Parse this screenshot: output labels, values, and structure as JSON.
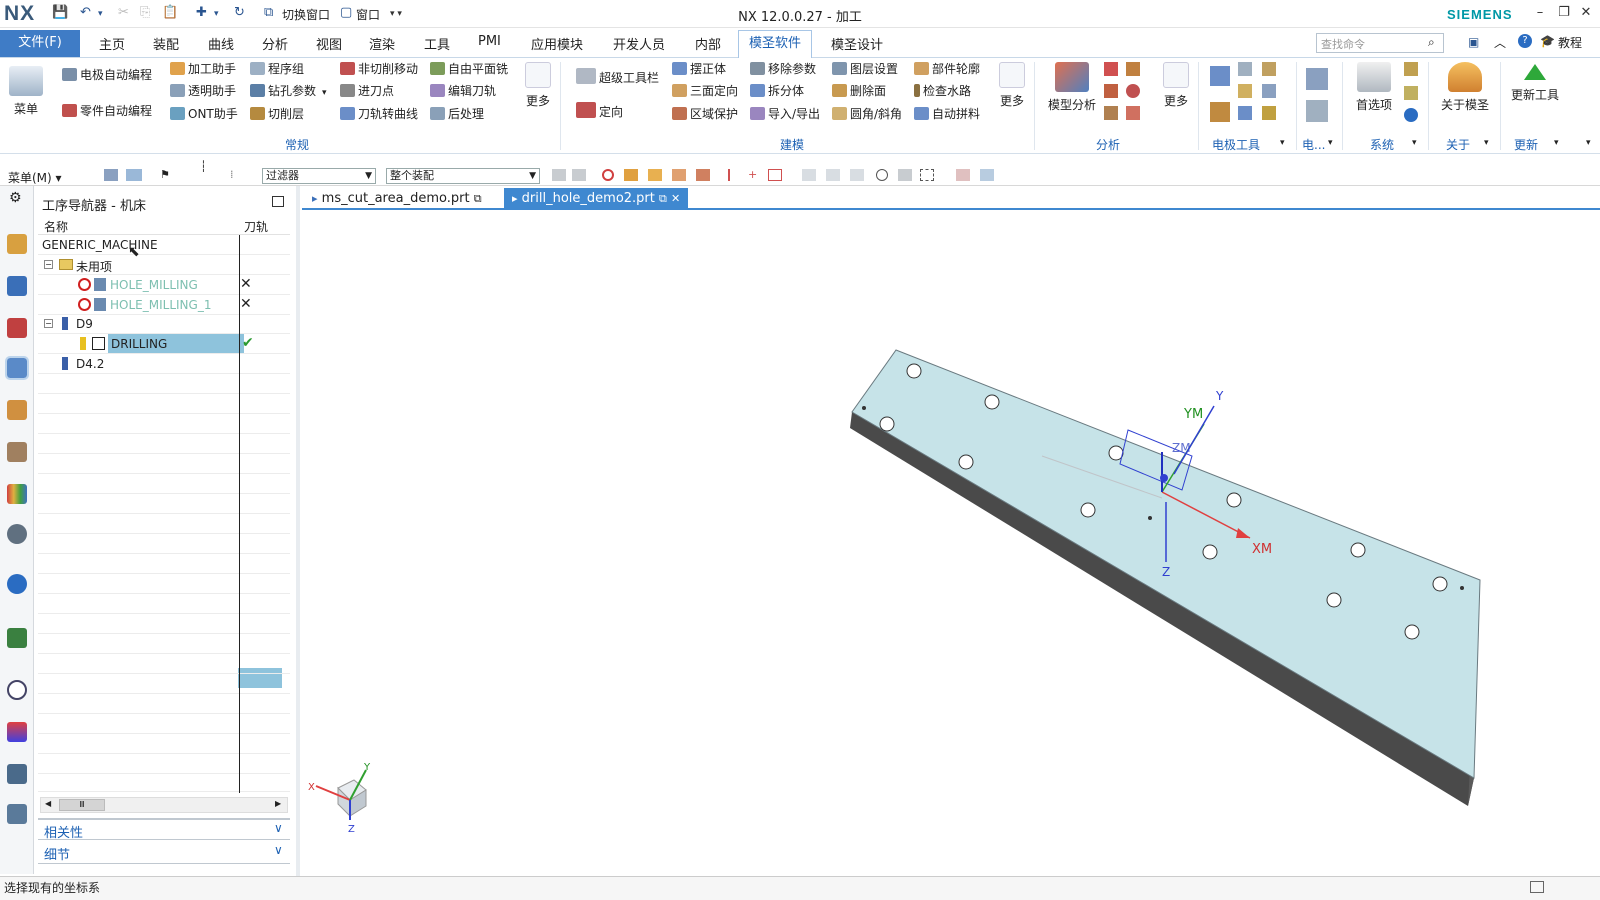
{
  "app": {
    "logo": "NX",
    "title": "NX 12.0.0.27 - 加工",
    "brand": "SIEMENS",
    "switch_window": "切换窗口",
    "window_menu": "窗口"
  },
  "menubar": {
    "file": "文件(F)",
    "tabs": [
      "主页",
      "装配",
      "曲线",
      "分析",
      "视图",
      "渲染",
      "工具",
      "PMI",
      "应用模块",
      "开发人员",
      "内部",
      "模圣软件",
      "模圣设计"
    ],
    "active_tab": "模圣软件",
    "search_placeholder": "查找命令",
    "tutorial": "教程"
  },
  "ribbon": {
    "menu_label": "菜单",
    "items": {
      "electrode_auto": "电极自动编程",
      "part_auto": "零件自动编程",
      "machining_helper": "加工助手",
      "transparent_helper": "透明助手",
      "ont_helper": "ONT助手",
      "program_group": "程序组",
      "drill_params": "钻孔参数",
      "cut_layer": "切削层",
      "non_cut_move": "非切削移动",
      "feed_point": "进刀点",
      "toolpath_curve": "刀轨转曲线",
      "free_face_mill": "自由平面铣",
      "edit_toolpath": "编辑刀轨",
      "post_process": "后处理",
      "more_1": "更多",
      "super_toolbar": "超级工具栏",
      "orient": "定向",
      "align_body": "摆正体",
      "three_orient": "三面定向",
      "zone_protect": "区域保护",
      "remove_params": "移除参数",
      "split_body": "拆分体",
      "import_export": "导入/导出",
      "layer_settings": "图层设置",
      "delete_face": "删除面",
      "fillet_chamfer": "圆角/斜角",
      "part_outline": "部件轮廓",
      "check_waterway": "检查水路",
      "auto_material": "自动拼料",
      "more_2": "更多",
      "model_analysis": "模型分析",
      "more_3": "更多",
      "preferences": "首选项",
      "about_mosheng": "关于模圣",
      "update_tools": "更新工具"
    },
    "groups": {
      "general": "常规",
      "modeling": "建模",
      "analysis": "分析",
      "electrode_tools": "电极工具",
      "electric": "电...",
      "system": "系统",
      "about": "关于",
      "update": "更新"
    }
  },
  "toolbar2": {
    "menu": "菜单(M)",
    "filter": "过滤器",
    "scope": "整个装配"
  },
  "navigator": {
    "title": "工序导航器 - 机床",
    "col_name": "名称",
    "col_toolpath": "刀轨",
    "rows": [
      {
        "name": "GENERIC_MACHINE",
        "status": ""
      },
      {
        "name": "未用项",
        "status": ""
      },
      {
        "name": "HOLE_MILLING",
        "status": "✕"
      },
      {
        "name": "HOLE_MILLING_1",
        "status": "✕"
      },
      {
        "name": "D9",
        "status": ""
      },
      {
        "name": "DRILLING",
        "status": "✔"
      },
      {
        "name": "D4.2",
        "status": ""
      }
    ],
    "dependencies": "相关性",
    "details": "细节"
  },
  "file_tabs": [
    {
      "name": "ms_cut_area_demo.prt"
    },
    {
      "name": "drill_hole_demo2.prt"
    }
  ],
  "viewport": {
    "axis_y": "Y",
    "axis_ym": "YM",
    "axis_zm": "ZM",
    "axis_xm": "XM",
    "axis_z": "Z",
    "triad_x": "X",
    "triad_y": "Y",
    "triad_z": "Z"
  },
  "status": {
    "message": "选择现有的坐标系"
  },
  "colors": {
    "accent": "#3f88d0",
    "selected_row": "#8ec3dc",
    "part_face": "#c6e3e8",
    "part_side": "#4a4a4a"
  }
}
